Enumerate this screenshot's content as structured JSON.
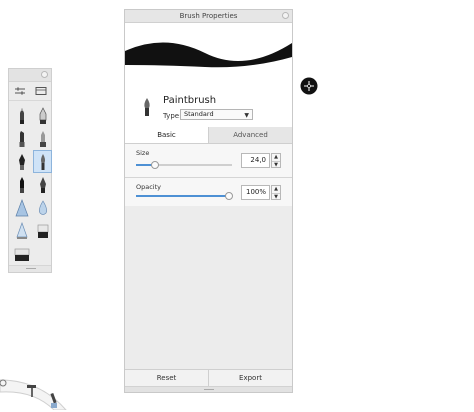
{
  "panel": {
    "title": "Brush Properties",
    "brush_name": "Paintbrush",
    "type_label": "Type:",
    "type_value": "Standard",
    "tabs": [
      {
        "label": "Basic",
        "active": true
      },
      {
        "label": "Advanced",
        "active": false
      }
    ],
    "size": {
      "label": "Size",
      "value": "24,0",
      "slider_fraction": 0.2
    },
    "opacity": {
      "label": "Opacity",
      "value": "100%",
      "slider_fraction": 1.0
    },
    "buttons": {
      "reset": "Reset",
      "export": "Export"
    }
  },
  "palette": {
    "toolbar": [
      "adjust-sliders-icon",
      "brush-library-icon"
    ],
    "brushes": [
      "pencil-brush-icon",
      "ballpoint-pen-icon",
      "marker-brush-icon",
      "felt-tip-icon",
      "ink-pen-icon",
      "paintbrush-icon",
      "airbrush-icon",
      "calligraphy-pen-icon",
      "triangle-brush-icon",
      "water-drop-icon",
      "cone-brush-icon",
      "eraser-icon",
      "block-eraser-icon"
    ],
    "selected_index": 5
  },
  "colors": {
    "accent": "#4d90d4",
    "selection": "#cfe3f7",
    "panel_bg": "#efefef"
  }
}
